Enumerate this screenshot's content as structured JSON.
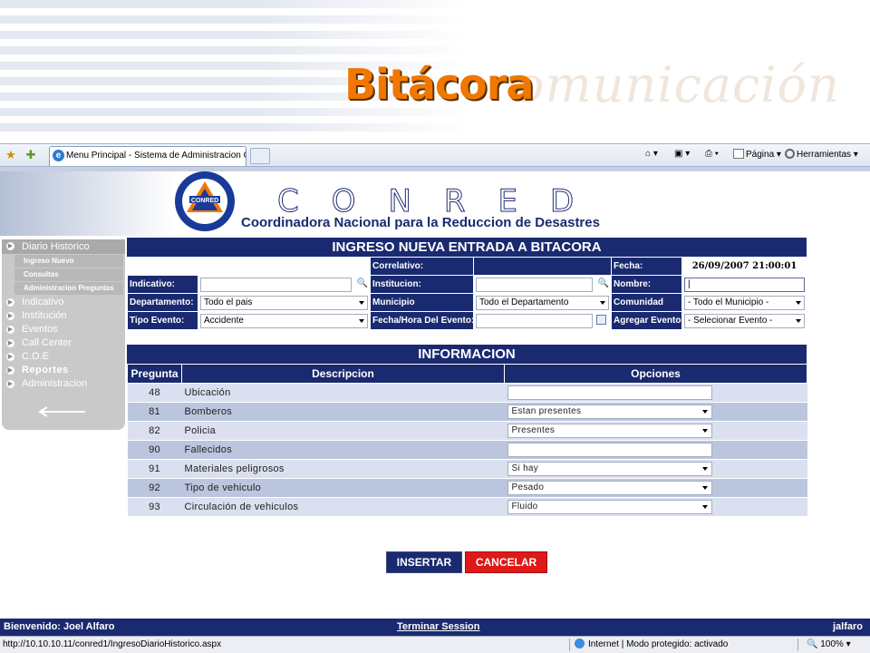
{
  "slide": {
    "title": "Bitácora",
    "watermark": "omunicación"
  },
  "browser": {
    "tab_title": "Menu Principal - Sistema de Administracion CO...",
    "commands": {
      "page": "Página",
      "tools": "Herramientas"
    }
  },
  "banner": {
    "logo_text": "CONRED",
    "letters": "CONRED",
    "subtitle": "Coordinadora Nacional para la Reduccion de Desastres"
  },
  "sidebar": {
    "items": [
      {
        "label": "Diario Historico",
        "sub": [
          "Ingreso Nuevo",
          "Consultas",
          "Administracion Preguntas"
        ]
      },
      {
        "label": "Indicativo"
      },
      {
        "label": "Institución"
      },
      {
        "label": "Eventos"
      },
      {
        "label": "Call Center"
      },
      {
        "label": "C.O.E"
      },
      {
        "label": "Reportes"
      },
      {
        "label": "Administracion"
      }
    ]
  },
  "form": {
    "title": "INGRESO NUEVA ENTRADA A BITACORA",
    "labels": {
      "correlativo": "Correlativo:",
      "fecha": "Fecha:",
      "indicativo": "Indicativo:",
      "institucion": "Institucion:",
      "nombre": "Nombre:",
      "departamento": "Departamento:",
      "municipio": "Municipio",
      "comunidad": "Comunidad",
      "tipo_evento": "Tipo Evento:",
      "fecha_hora": "Fecha/Hora Del Evento:",
      "agregar_evento": "Agregar Evento"
    },
    "values": {
      "fecha": "26/09/2007 21:00:01",
      "departamento": "Todo el pais",
      "municipio": "Todo el Departamento",
      "comunidad": "- Todo el Municipio -",
      "tipo_evento": "Accidente",
      "agregar_evento": "- Selecionar Evento -"
    }
  },
  "info": {
    "title": "INFORMACION",
    "columns": [
      "Pregunta",
      "Descripcion",
      "Opciones"
    ],
    "rows": [
      {
        "num": "48",
        "desc": "Ubicación",
        "option": ""
      },
      {
        "num": "81",
        "desc": "Bomberos",
        "option": "Estan presentes"
      },
      {
        "num": "82",
        "desc": "Policia",
        "option": "Presentes"
      },
      {
        "num": "90",
        "desc": "Fallecidos",
        "option": ""
      },
      {
        "num": "91",
        "desc": "Materiales peligrosos",
        "option": "Si hay"
      },
      {
        "num": "92",
        "desc": "Tipo de vehiculo",
        "option": "Pesado"
      },
      {
        "num": "93",
        "desc": "Circulación de vehiculos",
        "option": "Fluido"
      }
    ]
  },
  "buttons": {
    "insert": "INSERTAR",
    "cancel": "CANCELAR"
  },
  "footer": {
    "welcome": "Bienvenido:  Joel Alfaro",
    "logout": "Terminar Session",
    "user": "jalfaro"
  },
  "status": {
    "url": "http://10.10.10.11/conred1/IngresoDiarioHistorico.aspx",
    "zone": "Internet | Modo protegido: activado",
    "zoom": "100%"
  },
  "colors": {
    "navy": "#1a2a70",
    "cancel_red": "#e01818",
    "title_orange": "#f07800"
  }
}
